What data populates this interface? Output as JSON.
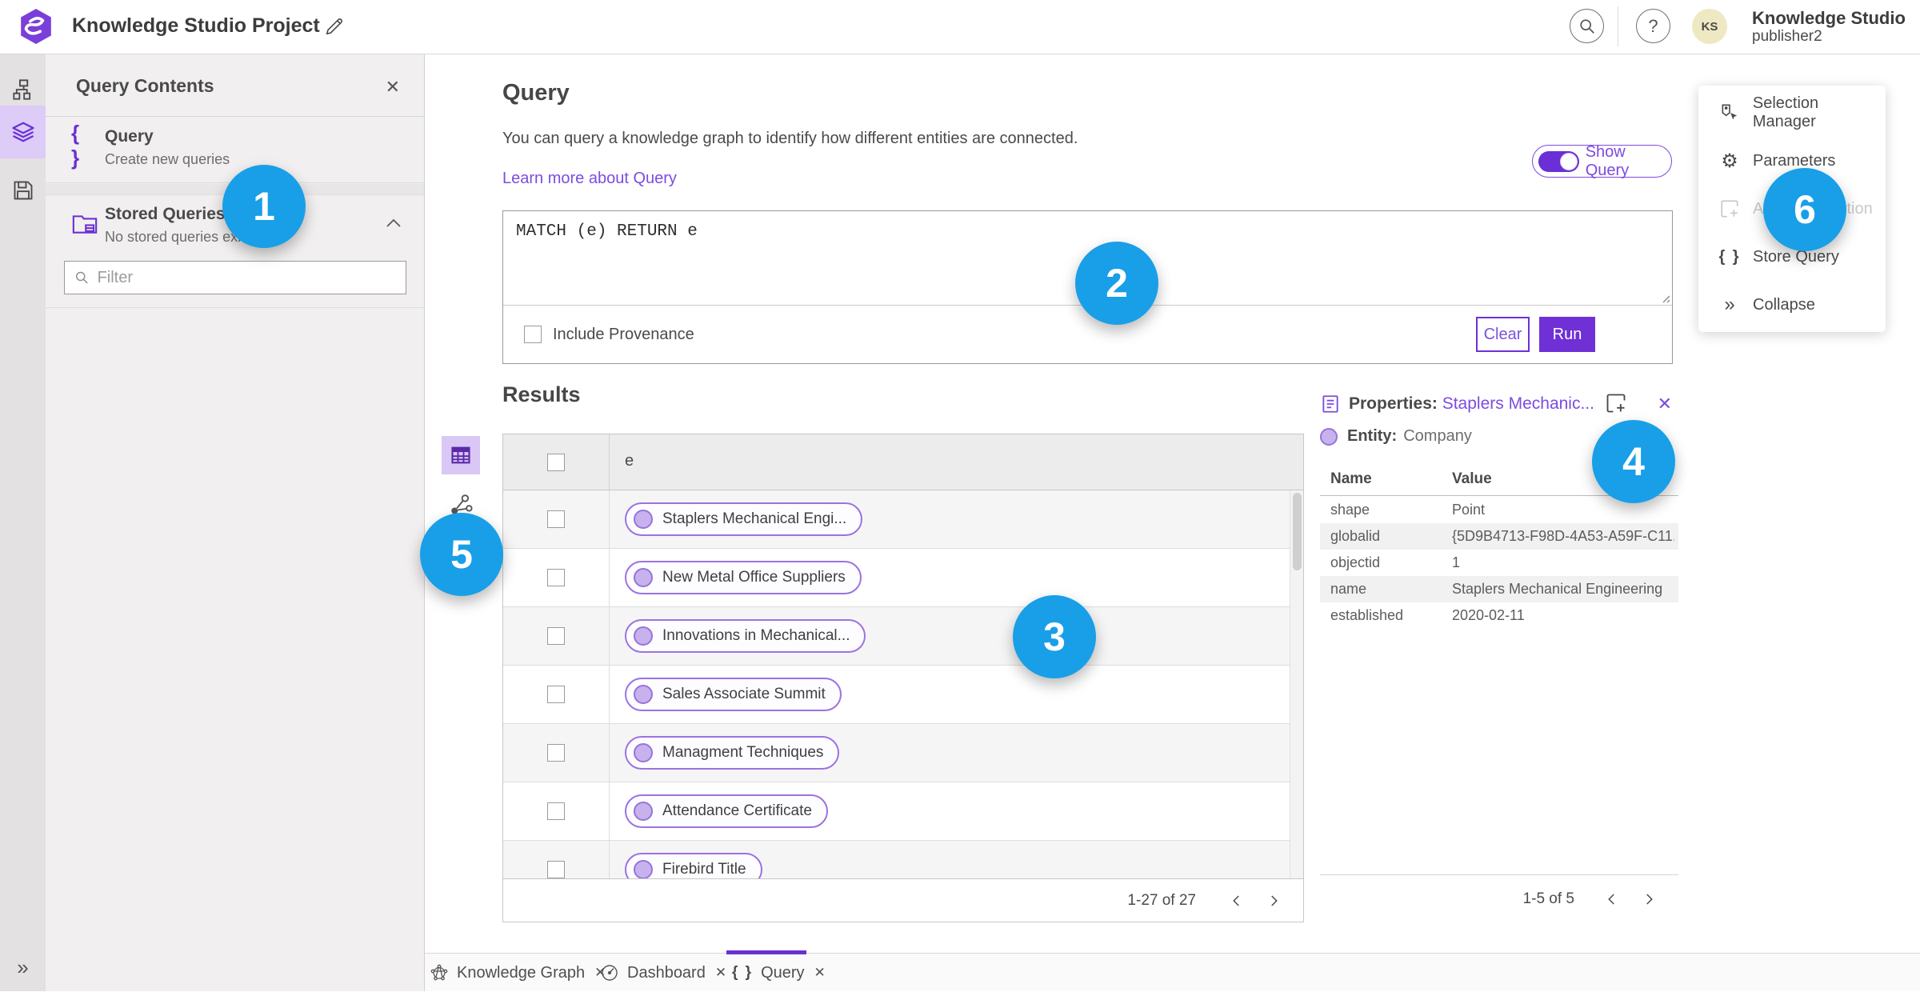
{
  "topbar": {
    "title": "Knowledge Studio Project",
    "app_name": "Knowledge Studio",
    "user": "publisher2",
    "avatar": "KS"
  },
  "left_panel": {
    "title": "Query Contents",
    "query": {
      "title": "Query",
      "subtitle": "Create new queries"
    },
    "stored": {
      "title": "Stored Queries",
      "subtitle": "No stored queries exist"
    },
    "filter_placeholder": "Filter"
  },
  "query": {
    "heading": "Query",
    "description": "You can query a knowledge graph to identify how different entities are connected.",
    "learn_more": "Learn more about Query",
    "show_query": "Show Query",
    "code": "MATCH (e) RETURN e",
    "include_provenance": "Include Provenance",
    "clear": "Clear",
    "run": "Run"
  },
  "results": {
    "heading": "Results",
    "column": "e",
    "rows": [
      {
        "label": "Staplers Mechanical Engi..."
      },
      {
        "label": "New Metal Office Suppliers"
      },
      {
        "label": "Innovations in Mechanical..."
      },
      {
        "label": "Sales Associate Summit"
      },
      {
        "label": "Managment Techniques"
      },
      {
        "label": "Attendance Certificate"
      },
      {
        "label": "Firebird Title"
      }
    ],
    "pagination": "1-27 of 27"
  },
  "properties": {
    "label": "Properties:",
    "name": "Staplers Mechanic...",
    "entity_label": "Entity:",
    "entity_type": "Company",
    "col_name": "Name",
    "col_value": "Value",
    "rows": [
      {
        "name": "shape",
        "value": "Point"
      },
      {
        "name": "globalid",
        "value": "{5D9B4713-F98D-4A53-A59F-C11..."
      },
      {
        "name": "objectid",
        "value": "1"
      },
      {
        "name": "name",
        "value": "Staplers Mechanical Engineering"
      },
      {
        "name": "established",
        "value": "2020-02-11"
      }
    ],
    "pagination": "1-5 of 5"
  },
  "menu": {
    "items": [
      {
        "label": "Selection Manager"
      },
      {
        "label": "Parameters"
      },
      {
        "label": "Add To Selection"
      },
      {
        "label": "Store Query"
      },
      {
        "label": "Collapse"
      }
    ]
  },
  "tabs": [
    {
      "label": "Knowledge Graph"
    },
    {
      "label": "Dashboard"
    },
    {
      "label": "Query"
    }
  ],
  "annotations": [
    {
      "n": "1"
    },
    {
      "n": "2"
    },
    {
      "n": "3"
    },
    {
      "n": "4"
    },
    {
      "n": "5"
    },
    {
      "n": "6"
    }
  ],
  "colors": {
    "accent_purple": "#6f30d6",
    "selected_lavender": "#ddcbf8",
    "link_purple": "#7b4ce0",
    "entity_fill": "#c8b2ee",
    "entity_border": "#9674d8",
    "annotation_blue": "#189fe8",
    "avatar_bg": "#eee9c2"
  }
}
